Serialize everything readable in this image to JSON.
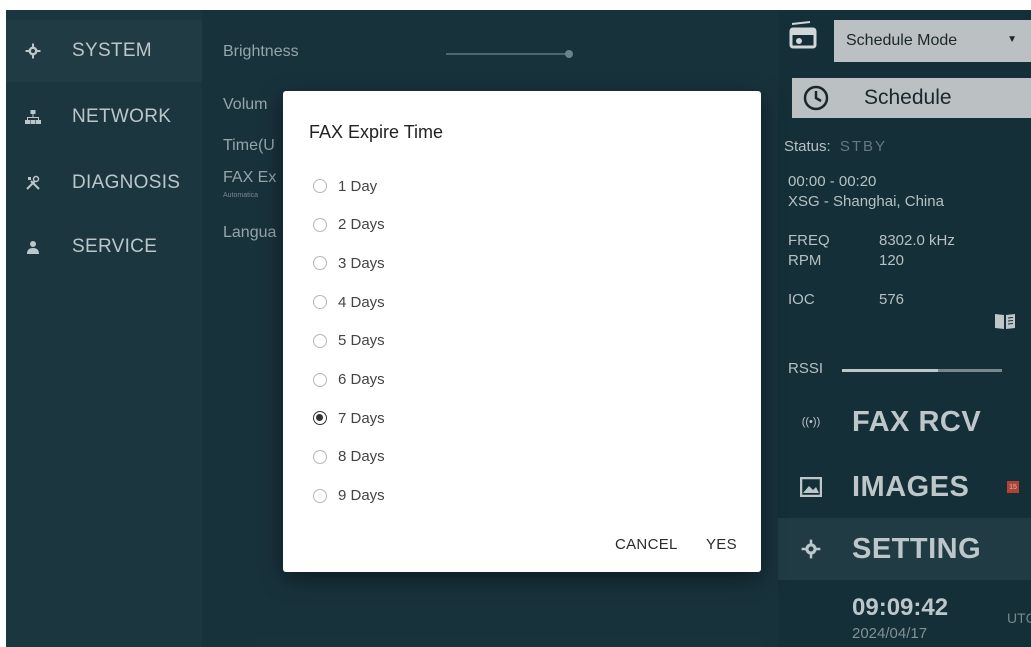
{
  "nav": {
    "items": [
      {
        "label": "SYSTEM",
        "icon": "gear-icon",
        "active": true
      },
      {
        "label": "NETWORK",
        "icon": "network-icon",
        "active": false
      },
      {
        "label": "DIAGNOSIS",
        "icon": "tools-icon",
        "active": false
      },
      {
        "label": "SERVICE",
        "icon": "person-icon",
        "active": false
      }
    ]
  },
  "settings": {
    "brightness": "Brightness",
    "volume": "Volum",
    "time": "Time(U",
    "fax_expire": "FAX Ex",
    "fax_expire_sub": "Automatica",
    "language": "Langua"
  },
  "right_panel": {
    "mode_select_value": "Schedule Mode",
    "schedule_button": "Schedule",
    "status_label": "Status:",
    "status_value": "STBY",
    "time_range": "00:00 - 00:20",
    "station": "XSG - Shanghai, China",
    "freq_label": "FREQ",
    "freq_value": "8302.0 kHz",
    "rpm_label": "RPM",
    "rpm_value": "120",
    "ioc_label": "IOC",
    "ioc_value": "576",
    "rssi_label": "RSSI",
    "rssi_level": 0.6,
    "fax_rcv": "FAX RCV",
    "images": "IMAGES",
    "images_badge": "15",
    "setting": "SETTING",
    "clock_time": "09:09:42",
    "clock_tz": "UTC",
    "clock_date": "2024/04/17"
  },
  "dialog": {
    "title": "FAX Expire Time",
    "options": [
      "1 Day",
      "2 Days",
      "3 Days",
      "4 Days",
      "5 Days",
      "6 Days",
      "7 Days",
      "8 Days",
      "9 Days"
    ],
    "selected": "7 Days",
    "cancel_label": "CANCEL",
    "yes_label": "YES"
  },
  "colors": {
    "background": "#16323b",
    "nav_background": "#1e3a44",
    "dialog_background": "#ffffff",
    "badge": "#b84a3a"
  }
}
